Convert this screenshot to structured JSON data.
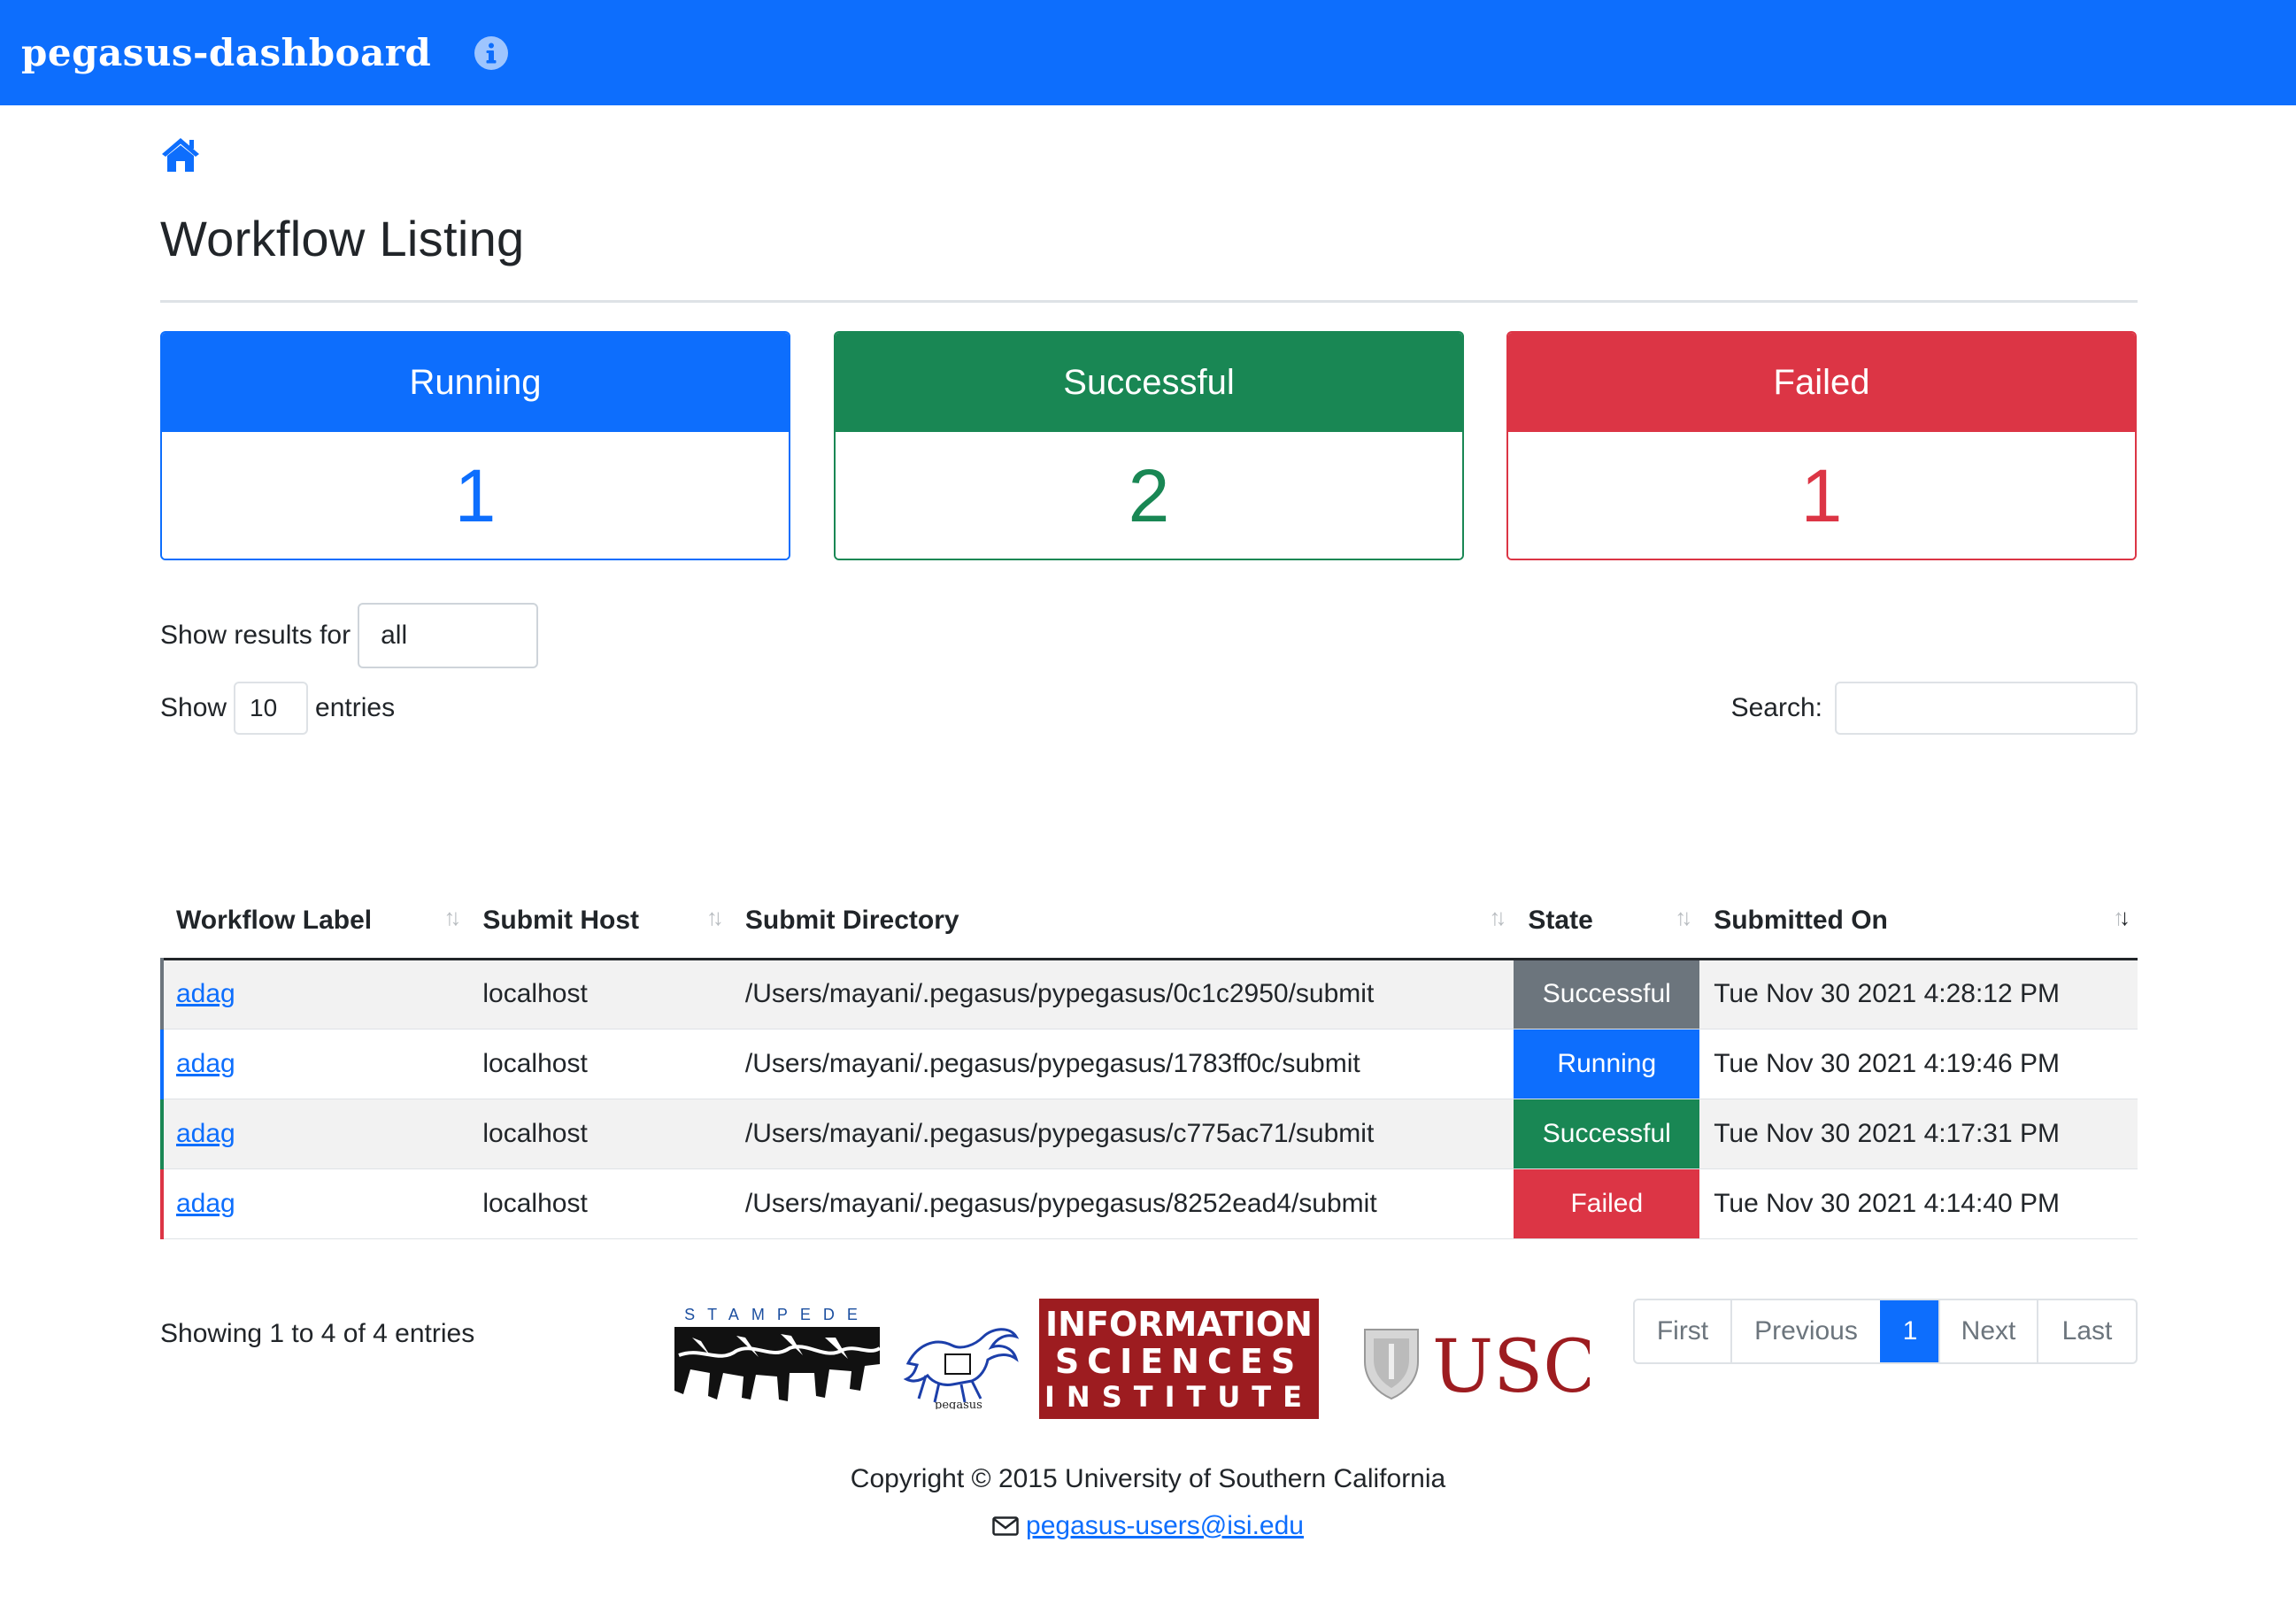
{
  "app": {
    "brand": "pegasus-dashboard"
  },
  "icons": {
    "info": "info-circle-icon",
    "home": "home-icon",
    "mail": "envelope-icon",
    "sort": "sort-arrows-icon"
  },
  "colors": {
    "primary": "#0d6efd",
    "success": "#198754",
    "danger": "#dc3545",
    "secondary": "#6c757d"
  },
  "page": {
    "title": "Workflow Listing"
  },
  "summary": [
    {
      "label": "Running",
      "count": "1"
    },
    {
      "label": "Successful",
      "count": "2"
    },
    {
      "label": "Failed",
      "count": "1"
    }
  ],
  "filter": {
    "label": "Show results for",
    "value": "all"
  },
  "length": {
    "prefix": "Show",
    "value": "10",
    "suffix": "entries"
  },
  "search": {
    "label": "Search:",
    "value": ""
  },
  "table": {
    "columns": [
      "Workflow Label",
      "Submit Host",
      "Submit Directory",
      "State",
      "Submitted On"
    ],
    "rows": [
      {
        "label": "adag",
        "host": "localhost",
        "dir": "/Users/mayani/.pegasus/pypegasus/0c1c2950/submit",
        "state": "Successful",
        "submitted": "Tue Nov 30 2021 4:28:12 PM"
      },
      {
        "label": "adag",
        "host": "localhost",
        "dir": "/Users/mayani/.pegasus/pypegasus/1783ff0c/submit",
        "state": "Running",
        "submitted": "Tue Nov 30 2021 4:19:46 PM"
      },
      {
        "label": "adag",
        "host": "localhost",
        "dir": "/Users/mayani/.pegasus/pypegasus/c775ac71/submit",
        "state": "Successful",
        "submitted": "Tue Nov 30 2021 4:17:31 PM"
      },
      {
        "label": "adag",
        "host": "localhost",
        "dir": "/Users/mayani/.pegasus/pypegasus/8252ead4/submit",
        "state": "Failed",
        "submitted": "Tue Nov 30 2021 4:14:40 PM"
      }
    ]
  },
  "info": "Showing 1 to 4 of 4 entries",
  "pagination": [
    "First",
    "Previous",
    "1",
    "Next",
    "Last"
  ],
  "footer": {
    "logos": {
      "stampede": "STAMPEDE",
      "pegasus": "pegasus",
      "isi": [
        "INFORMATION",
        "SCIENCES",
        "INSTITUTE"
      ],
      "usc": "USC"
    },
    "copyright": "Copyright © 2015 University of Southern California",
    "email": "pegasus-users@isi.edu"
  }
}
